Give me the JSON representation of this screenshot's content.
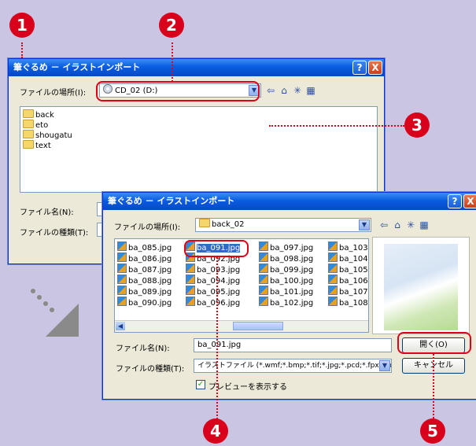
{
  "badges": [
    "1",
    "2",
    "3",
    "4",
    "5"
  ],
  "colors": {
    "accent_red": "#d9001c",
    "titlebar_blue": "#0a5de0",
    "background": "#c9c5e2"
  },
  "dialog1": {
    "title": "筆ぐるめ － イラストインポート",
    "help_label": "?",
    "close_label": "X",
    "lookin_label": "ファイルの場所(I):",
    "lookin_value": "CD_02 (D:)",
    "folders": [
      "back",
      "eto",
      "shougatu",
      "text"
    ],
    "filename_label": "ファイル名(N):",
    "filetype_label": "ファイルの種類(T):",
    "icons": [
      "back-arrow-icon",
      "up-folder-icon",
      "new-folder-icon",
      "view-menu-icon"
    ]
  },
  "dialog2": {
    "title": "筆ぐるめ － イラストインポート",
    "help_label": "?",
    "close_label": "X",
    "lookin_label": "ファイルの場所(I):",
    "lookin_value": "back_02",
    "columns": [
      [
        "ba_085.jpg",
        "ba_086.jpg",
        "ba_087.jpg",
        "ba_088.jpg",
        "ba_089.jpg",
        "ba_090.jpg"
      ],
      [
        "ba_091.jpg",
        "ba_092.jpg",
        "ba_093.jpg",
        "ba_094.jpg",
        "ba_095.jpg",
        "ba_096.jpg"
      ],
      [
        "ba_097.jpg",
        "ba_098.jpg",
        "ba_099.jpg",
        "ba_100.jpg",
        "ba_101.jpg",
        "ba_102.jpg"
      ],
      [
        "ba_103",
        "ba_104",
        "ba_105",
        "ba_106",
        "ba_107",
        "ba_108"
      ]
    ],
    "selected_file": "ba_091.jpg",
    "filename_label": "ファイル名(N):",
    "filename_value": "ba_091.jpg",
    "filetype_label": "ファイルの種類(T):",
    "filetype_value": "イラストファイル (*.wmf;*.bmp;*.tif;*.jpg;*.pcd;*.fpx;*.pr",
    "open_button": "開く(O)",
    "cancel_button": "キャンセル",
    "preview_checkbox_label": "プレビューを表示する",
    "preview_checked": true
  }
}
